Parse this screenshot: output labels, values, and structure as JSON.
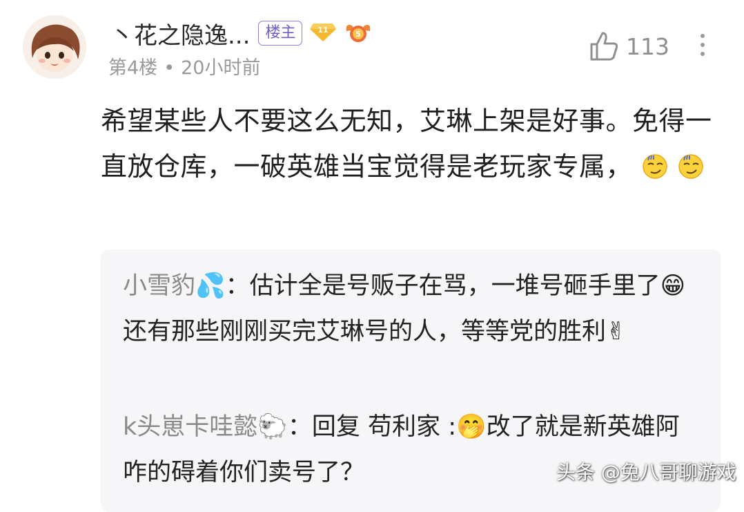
{
  "comment": {
    "username": "丶花之隐逸...",
    "op_badge": "楼主",
    "level_badge": "11",
    "medal_badge": "5",
    "floor": "第4楼",
    "separator": "•",
    "time": "20小时前",
    "like_count": "113",
    "text_part1": "希望某些人不要这么无知，艾琳上架是好事。免得一直放仓库，一破英雄当宝觉得是老玩家专属，",
    "emoji_1": "smirk-emoji",
    "emoji_2": "smirk-emoji"
  },
  "replies": [
    {
      "name": "小雪豹",
      "name_emoji": "💦",
      "colon": "：",
      "text_a": "估计全是号贩子在骂，一堆号砸手里了",
      "emoji_mid": "😁",
      "text_b": "还有那些刚刚买完艾琳号的人，等等党的胜利",
      "emoji_end": "✌"
    },
    {
      "name": "k头崽卡哇懿",
      "name_emoji": "🐑",
      "colon": "：",
      "reply_prefix": "回复",
      "reply_to": "苟利家",
      "reply_colon": ":",
      "emoji_mid": "🤭",
      "text_b": "改了就是新英雄阿 咋的碍着你们卖号了？"
    }
  ],
  "watermark": "头条 @兔八哥聊游戏",
  "colors": {
    "accent_purple": "#6c5fc7",
    "meta_gray": "#9a9a9a",
    "reply_bg": "#f6f6f8",
    "level_gold": "#f5b92e"
  }
}
